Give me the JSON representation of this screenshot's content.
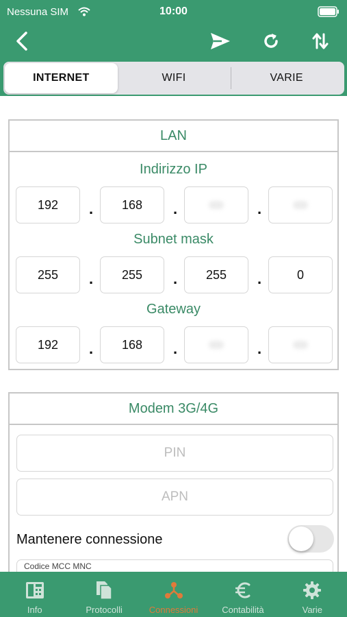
{
  "status": {
    "carrier": "Nessuna SIM",
    "time": "10:00"
  },
  "tabs": [
    {
      "label": "INTERNET",
      "active": true
    },
    {
      "label": "WIFI",
      "active": false
    },
    {
      "label": "VARIE",
      "active": false
    }
  ],
  "lan": {
    "title": "LAN",
    "ip_label": "Indirizzo IP",
    "ip": [
      "192",
      "168",
      "",
      ""
    ],
    "subnet_label": "Subnet mask",
    "subnet": [
      "255",
      "255",
      "255",
      "0"
    ],
    "gateway_label": "Gateway",
    "gateway": [
      "192",
      "168",
      "",
      ""
    ],
    "separator": "."
  },
  "modem": {
    "title": "Modem 3G/4G",
    "pin_placeholder": "PIN",
    "apn_placeholder": "APN",
    "keep_connection_label": "Mantenere connessione",
    "keep_connection_on": false,
    "mcc_label": "Codice MCC MNC"
  },
  "tabbar": [
    {
      "label": "Info",
      "icon": "info-register-icon",
      "active": false
    },
    {
      "label": "Protocolli",
      "icon": "documents-icon",
      "active": false
    },
    {
      "label": "Connessioni",
      "icon": "network-icon",
      "active": true
    },
    {
      "label": "Contabilità",
      "icon": "euro-icon",
      "active": false
    },
    {
      "label": "Varie",
      "icon": "gear-icon",
      "active": false
    }
  ],
  "colors": {
    "brand_green": "#3a9a70",
    "label_green": "#3a8a66",
    "active_orange": "#e07a3a"
  }
}
